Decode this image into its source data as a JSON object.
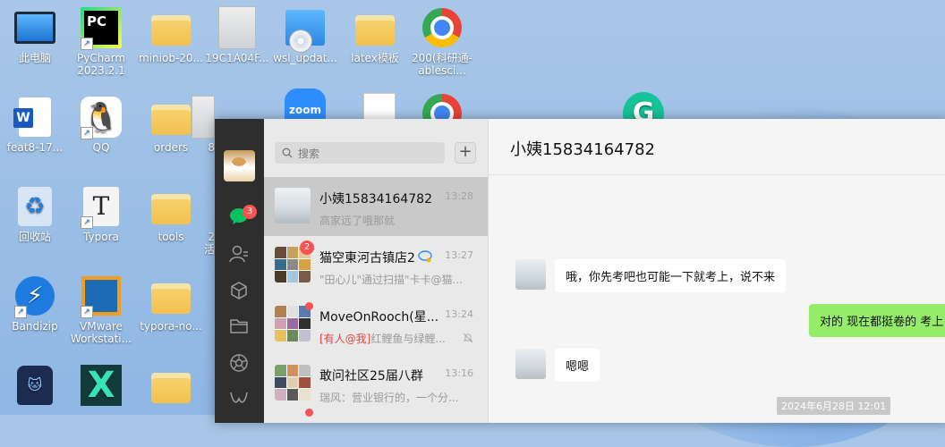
{
  "desktop": {
    "icons": [
      {
        "label": "此电脑",
        "icon": "monitor-icon"
      },
      {
        "label": "PyCharm 2023.2.1",
        "icon": "pycharm-icon"
      },
      {
        "label": "miniob-20...",
        "icon": "folder-icon"
      },
      {
        "label": "19C1A04F...",
        "icon": "photo-file-icon"
      },
      {
        "label": "wsl_updat...",
        "icon": "installer-icon"
      },
      {
        "label": "latex模板",
        "icon": "folder-icon"
      },
      {
        "label": "200(科研通-ablesci...",
        "icon": "chrome-icon"
      },
      {
        "label": "feat8-17...",
        "icon": "word-icon"
      },
      {
        "label": "QQ",
        "icon": "qq-icon"
      },
      {
        "label": "orders",
        "icon": "folder-icon"
      },
      {
        "label": "回收站",
        "icon": "recycle-bin-icon"
      },
      {
        "label": "Typora",
        "icon": "typora-icon"
      },
      {
        "label": "tools",
        "icon": "folder-icon"
      },
      {
        "label": "Bandizip",
        "icon": "bandizip-icon"
      },
      {
        "label": "VMware Workstati...",
        "icon": "vmware-icon"
      },
      {
        "label": "typora-no...",
        "icon": "folder-icon"
      },
      {
        "label": "zoom",
        "icon": "zoom-icon"
      },
      {
        "label": "G",
        "icon": "grammarly-icon"
      }
    ],
    "partial_labels": [
      "8",
      "2",
      "活"
    ]
  },
  "wechat": {
    "search_placeholder": "搜索",
    "plus_label": "+",
    "nav": {
      "unread_badge": "3"
    },
    "chats": [
      {
        "name": "小姨15834164782",
        "time": "13:28",
        "preview": "高家远了哦那就",
        "badge": "",
        "active": true
      },
      {
        "name": "猫空東河古镇店2",
        "time": "13:27",
        "preview": "\"田心儿\"通过扫描\"卡卡@猫...",
        "badge": "2",
        "active": false
      },
      {
        "name": "MoveOnRooch(星...",
        "time": "13:24",
        "preview_tag": "[有人@我]",
        "preview": "红鲤鱼与绿鲤...",
        "badge": "dot",
        "active": false
      },
      {
        "name": "敢问社区25届八群",
        "time": "13:16",
        "preview": "瑞风：营业银行的，一个分...",
        "badge": "",
        "active": false
      }
    ],
    "conversation": {
      "title": "小姨15834164782",
      "messages": [
        {
          "side": "left",
          "text": "哦，你先考吧也可能一下就考上，说不来"
        },
        {
          "side": "right",
          "text": "对的 现在都挺卷的 考上"
        },
        {
          "side": "left",
          "text": "嗯嗯"
        }
      ],
      "timestamp": "2024年6月28日 12:01"
    }
  }
}
